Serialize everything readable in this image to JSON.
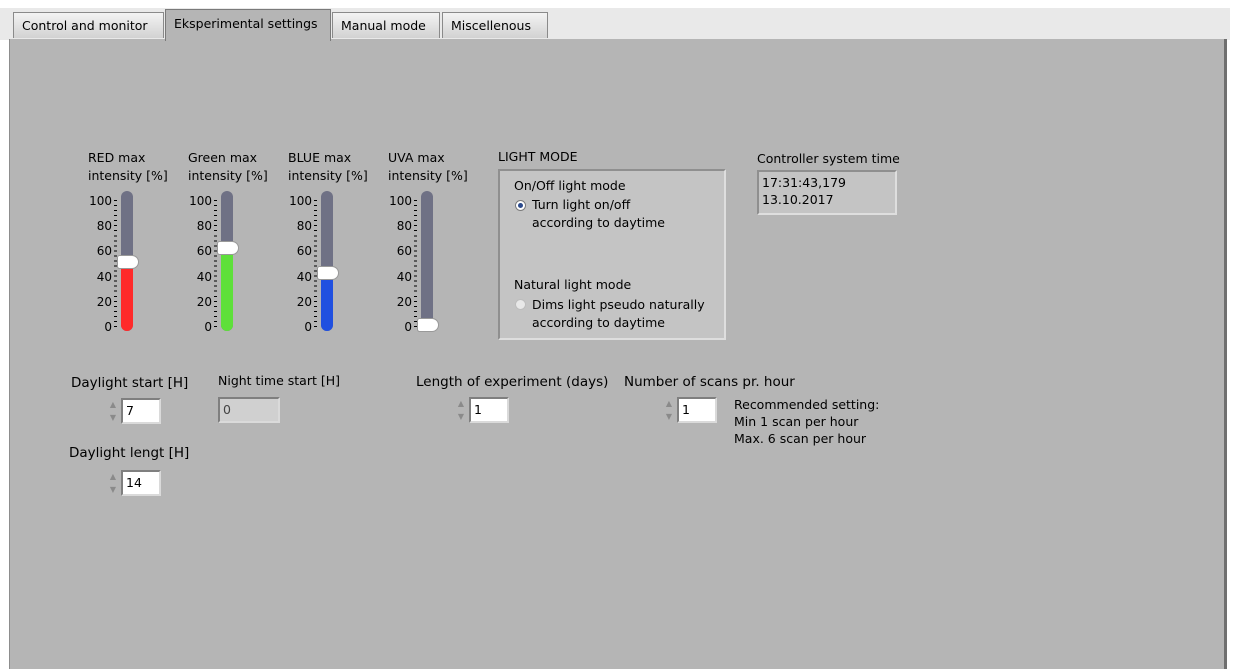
{
  "tabs": [
    "Control and monitor",
    "Eksperimental settings",
    "Manual mode",
    "Miscellenous"
  ],
  "active_tab": 1,
  "sliders": [
    {
      "label": "RED max\nintensity [%]",
      "value": 49,
      "color": "#ff2a2a"
    },
    {
      "label": "Green max\nintensity [%]",
      "value": 60,
      "color": "#5ee03a"
    },
    {
      "label": "BLUE max\nintensity [%]",
      "value": 41,
      "color": "#2050e0"
    },
    {
      "label": "UVA max\nintensity [%]",
      "value": 0,
      "color": "#e020e0"
    }
  ],
  "slider_ticks": [
    "100",
    "80",
    "60",
    "40",
    "20",
    "0"
  ],
  "light_mode": {
    "title": "LIGHT MODE",
    "onoff_title": "On/Off light mode",
    "onoff_option": "Turn light on/off\naccording to daytime",
    "natural_title": "Natural light mode",
    "natural_option": "Dims light pseudo naturally\naccording to daytime",
    "selected": "onoff"
  },
  "system_time": {
    "label": "Controller system time",
    "time": "17:31:43,179",
    "date": "13.10.2017"
  },
  "daylight_start": {
    "label": "Daylight start [H]",
    "value": "7"
  },
  "night_start": {
    "label": "Night time start [H]",
    "value": "0"
  },
  "daylight_length": {
    "label": "Daylight lengt [H]",
    "value": "14"
  },
  "experiment_length": {
    "label": "Length of experiment (days)",
    "value": "1"
  },
  "scans_per_hour": {
    "label": "Number of scans pr. hour",
    "value": "1"
  },
  "recommendation": "Recommended setting:\nMin 1 scan per hour\nMax. 6 scan per hour"
}
